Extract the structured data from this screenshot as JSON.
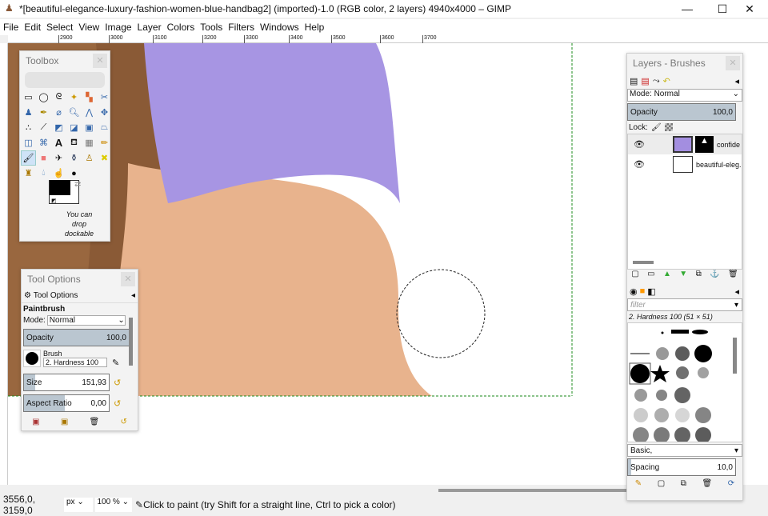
{
  "window": {
    "title": "*[beautiful-elegance-luxury-fashion-women-blue-handbag2] (imported)-1.0 (RGB color, 2 layers) 4940x4000 – GIMP",
    "minimize": "—",
    "maximize": "☐",
    "close": "✕"
  },
  "menu": [
    "File",
    "Edit",
    "Select",
    "View",
    "Image",
    "Layer",
    "Colors",
    "Tools",
    "Filters",
    "Windows",
    "Help"
  ],
  "ruler": [
    "2900",
    "3000",
    "3100",
    "3200",
    "3300",
    "3400",
    "3500",
    "3600",
    "3700"
  ],
  "toolbox": {
    "title": "Toolbox",
    "dock_hint": "You can drop dockable"
  },
  "tool_options": {
    "title": "Tool Options",
    "tab": "Tool Options",
    "tool": "Paintbrush",
    "mode_label": "Mode:",
    "mode": "Normal",
    "opacity_label": "Opacity",
    "opacity": "100,0",
    "brush_label": "Brush",
    "brush": "2. Hardness 100",
    "size_label": "Size",
    "size": "151,93",
    "aspect_label": "Aspect Ratio",
    "aspect": "0,00"
  },
  "layers": {
    "title": "Layers - Brushes",
    "mode_label": "Mode: Normal",
    "opacity_label": "Opacity",
    "opacity": "100,0",
    "lock_label": "Lock:",
    "items": [
      {
        "name": "confide"
      },
      {
        "name": "beautiful-eleg."
      }
    ]
  },
  "brushes": {
    "filter_placeholder": "filter",
    "current": "2. Hardness 100 (51 × 51)",
    "tag": "Basic,",
    "spacing_label": "Spacing",
    "spacing": "10,0"
  },
  "status": {
    "coords": "3556,0, 3159,0",
    "unit": "px",
    "zoom": "100 %",
    "message": "Click to paint (try Shift for a straight line, Ctrl to pick a color)"
  },
  "colors": {
    "fg": "#000000",
    "bg": "#ffffff",
    "sleeve": "#a38ee0",
    "skin": "#e9b08a"
  }
}
